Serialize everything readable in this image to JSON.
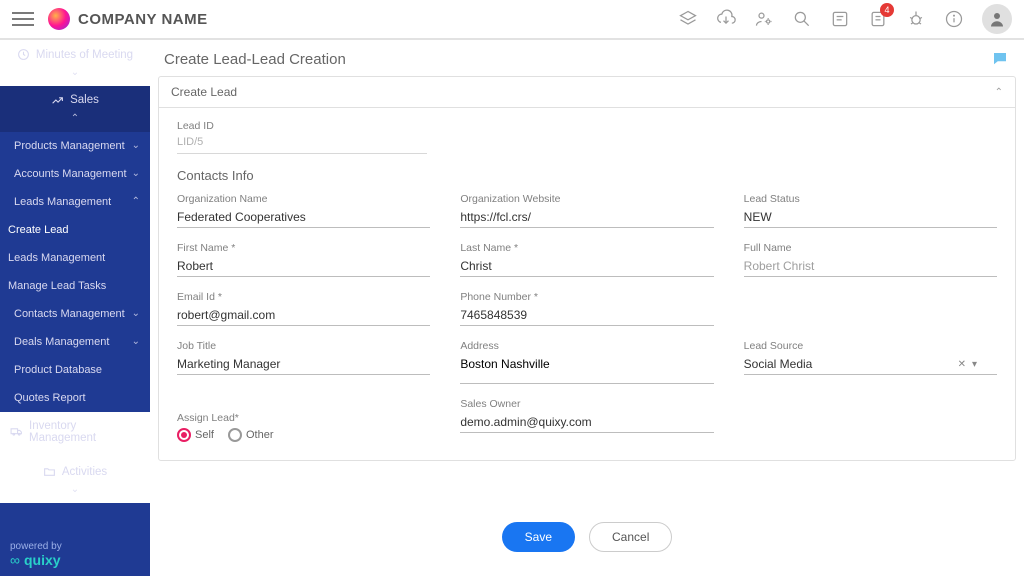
{
  "brand": "COMPANY NAME",
  "header": {
    "notif_count": "4"
  },
  "sidebar": {
    "items": [
      {
        "label": "Minutes of Meeting",
        "icon": "clock-icon"
      },
      {
        "label": "Sales",
        "icon": "chart-icon"
      },
      {
        "label": "Products Management"
      },
      {
        "label": "Accounts Management"
      },
      {
        "label": "Leads Management"
      },
      {
        "label": "Create Lead"
      },
      {
        "label": "Leads Management"
      },
      {
        "label": "Manage Lead Tasks"
      },
      {
        "label": "Contacts Management"
      },
      {
        "label": "Deals Management"
      },
      {
        "label": "Product Database"
      },
      {
        "label": "Quotes Report"
      },
      {
        "label": "Inventory Management",
        "icon": "truck-icon"
      },
      {
        "label": "Activities",
        "icon": "folder-icon"
      }
    ],
    "powered_label": "powered by",
    "powered_brand": "quixy"
  },
  "page": {
    "title": "Create Lead-Lead Creation",
    "panel_title": "Create Lead",
    "lead_id_label": "Lead ID",
    "lead_id_value": "LID/5",
    "section_contacts": "Contacts Info",
    "fields": {
      "org_name": {
        "label": "Organization Name",
        "value": "Federated Cooperatives"
      },
      "org_site": {
        "label": "Organization Website",
        "value": "https://fcl.crs/"
      },
      "lead_status": {
        "label": "Lead Status",
        "value": "NEW"
      },
      "first_name": {
        "label": "First Name *",
        "value": "Robert"
      },
      "last_name": {
        "label": "Last Name *",
        "value": "Christ"
      },
      "full_name": {
        "label": "Full Name",
        "value": "Robert  Christ"
      },
      "email": {
        "label": "Email Id *",
        "value": "robert@gmail.com"
      },
      "phone": {
        "label": "Phone Number *",
        "value": "7465848539"
      },
      "job_title": {
        "label": "Job Title",
        "value": "Marketing Manager"
      },
      "address": {
        "label": "Address",
        "value": "Boston Nashville"
      },
      "lead_source": {
        "label": "Lead Source",
        "value": "Social Media"
      },
      "sales_owner": {
        "label": "Sales Owner",
        "value": "demo.admin@quixy.com"
      }
    },
    "assign": {
      "label": "Assign Lead*",
      "options": {
        "self": "Self",
        "other": "Other"
      },
      "selected": "self"
    },
    "actions": {
      "save": "Save",
      "cancel": "Cancel"
    }
  }
}
